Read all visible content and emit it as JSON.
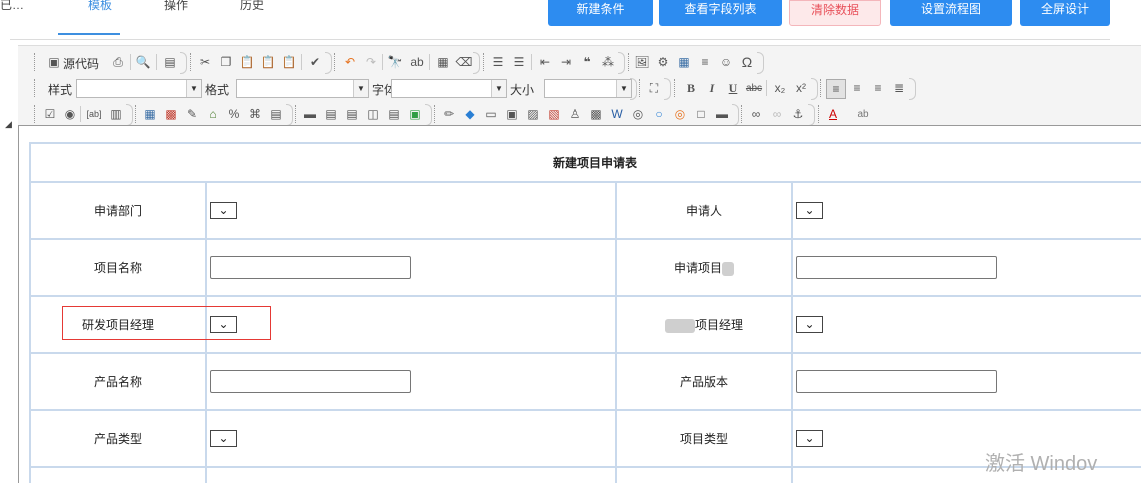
{
  "top_tabs": [
    {
      "label": "已…",
      "active": false
    },
    {
      "label": "模板",
      "active": true
    },
    {
      "label": "操作",
      "active": false
    },
    {
      "label": "历史",
      "active": false
    }
  ],
  "top_buttons": [
    {
      "label": "新建条件"
    },
    {
      "label": "查看字段列表"
    },
    {
      "label": "清除数据"
    },
    {
      "label": "设置流程图"
    },
    {
      "label": "全屏设计"
    }
  ],
  "toolbar": {
    "source_label": "源代码",
    "style_label": "样式",
    "format_label": "格式",
    "font_label": "字体",
    "size_label": "大小"
  },
  "form": {
    "title": "新建项目申请表",
    "rows": [
      {
        "left_label": "申请部门",
        "left_type": "select",
        "right_label": "申请人",
        "right_type": "select"
      },
      {
        "left_label": "项目名称",
        "left_type": "text",
        "right_label": "申请项目",
        "right_type": "text",
        "right_blurred": true
      },
      {
        "left_label": "研发项目经理",
        "left_type": "select",
        "right_label": "项目经理",
        "right_type": "select",
        "right_prefix_blurred": true,
        "highlighted": true
      },
      {
        "left_label": "产品名称",
        "left_type": "text",
        "right_label": "产品版本",
        "right_type": "text"
      },
      {
        "left_label": "产品类型",
        "left_type": "select",
        "right_label": "项目类型",
        "right_type": "select"
      }
    ]
  },
  "watermark": "激活 Windov",
  "colors": {
    "primary": "#2d8cf0",
    "highlight": "#e53935",
    "table_border": "#c9d9ec"
  }
}
